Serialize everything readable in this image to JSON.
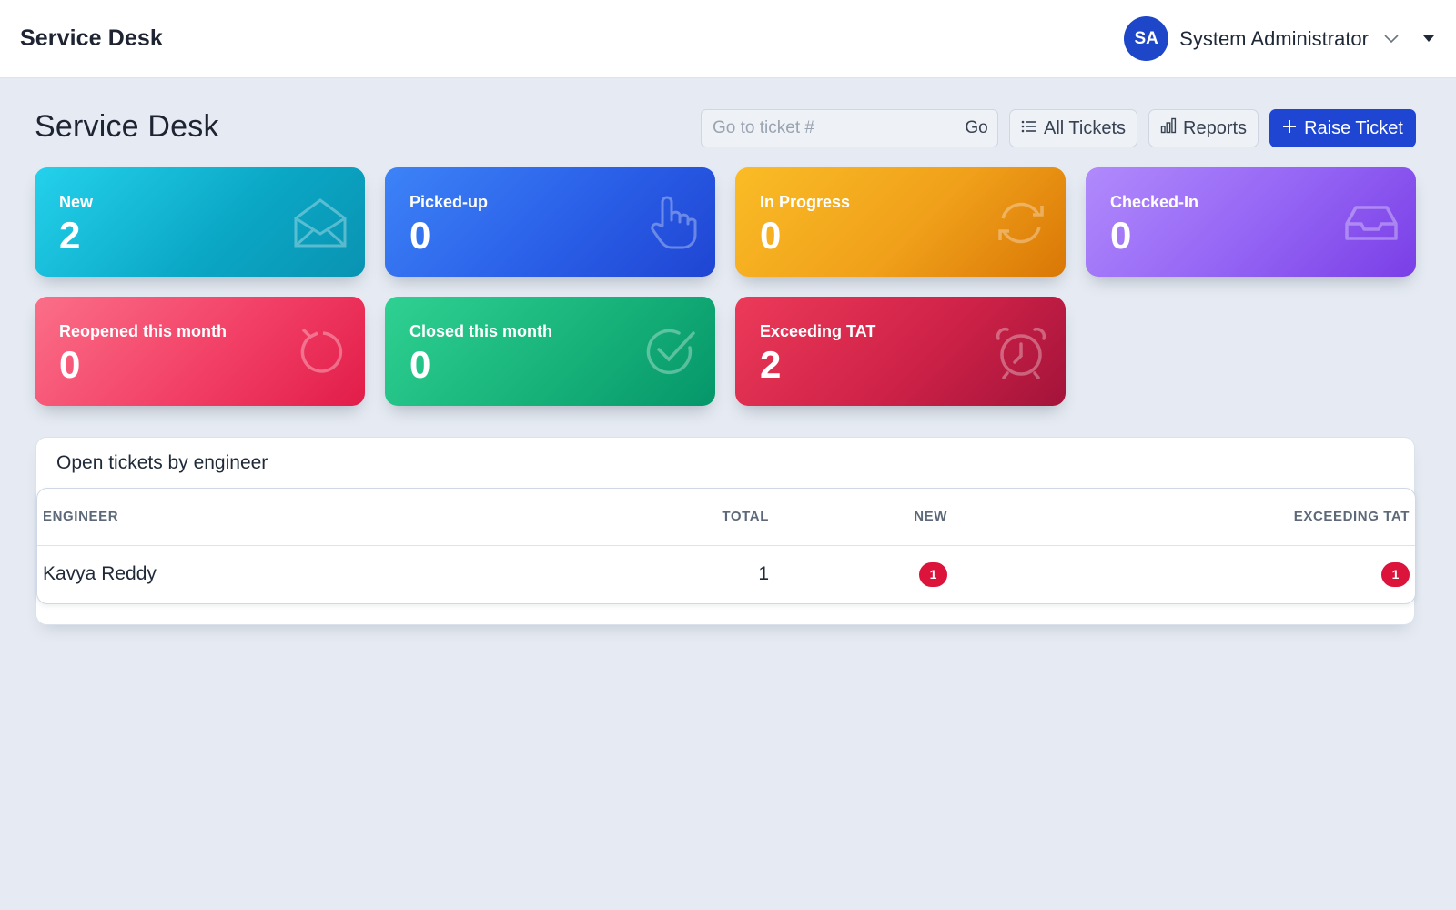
{
  "navbar": {
    "brand": "Service Desk",
    "user": {
      "initials": "SA",
      "name": "System Administrator"
    }
  },
  "header": {
    "title": "Service Desk",
    "search": {
      "placeholder": "Go to ticket #",
      "go_label": "Go"
    },
    "all_tickets_label": "All Tickets",
    "reports_label": "Reports",
    "raise_ticket_label": "Raise Ticket"
  },
  "cards": {
    "new": {
      "label": "New",
      "value": "2",
      "icon": "envelope-open-icon"
    },
    "picked_up": {
      "label": "Picked-up",
      "value": "0",
      "icon": "hand-pointer-icon"
    },
    "in_progress": {
      "label": "In Progress",
      "value": "0",
      "icon": "sync-arrows-icon"
    },
    "checked_in": {
      "label": "Checked-In",
      "value": "0",
      "icon": "inbox-tray-icon"
    },
    "reopened": {
      "label": "Reopened this month",
      "value": "0",
      "icon": "rotate-left-icon"
    },
    "closed": {
      "label": "Closed this month",
      "value": "0",
      "icon": "check-circle-icon"
    },
    "exceeding_tat": {
      "label": "Exceeding TAT",
      "value": "2",
      "icon": "alarm-clock-icon"
    }
  },
  "engineers": {
    "title": "Open tickets by engineer",
    "columns": {
      "engineer": "ENGINEER",
      "total": "TOTAL",
      "new": "NEW",
      "exceeding_tat": "EXCEEDING TAT"
    },
    "rows": [
      {
        "engineer": "Kavya Reddy",
        "total": "1",
        "new": "1",
        "exceeding_tat": "1"
      }
    ]
  },
  "colors": {
    "primary": "#1e46d2",
    "badge_danger": "#dc143c",
    "background": "#e6ebf3"
  }
}
